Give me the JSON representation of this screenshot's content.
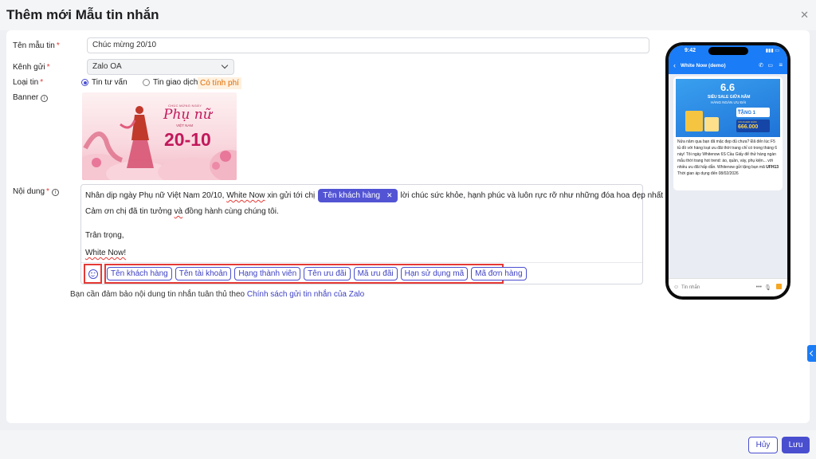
{
  "modal": {
    "title": "Thêm mới Mẫu tin nhắn",
    "close_icon": "close-icon"
  },
  "form": {
    "template_name": {
      "label": "Tên mẫu tin",
      "value": "Chúc mừng 20/10"
    },
    "channel": {
      "label": "Kênh gửi",
      "value": "Zalo OA"
    },
    "message_type": {
      "label": "Loại tin",
      "options": [
        "Tin tư vấn",
        "Tin giao dịch"
      ],
      "selected": "Tin tư vấn",
      "paid_badge": "Có tính phí"
    },
    "banner": {
      "label": "Banner",
      "image_text": {
        "small": "CHÚC MỪNG NGÀY",
        "script": "Phụ nữ",
        "country": "VIỆT NAM",
        "date": "20-10"
      }
    },
    "content": {
      "label": "Nội dung",
      "line1_before": "Nhân dịp ngày Phụ nữ Việt Nam 20/10, ",
      "line1_brand": "White Now",
      "line1_mid": " xin gửi tới chị",
      "inline_tag": "Tên khách hàng",
      "line1_after": "lời chúc sức khỏe, hạnh phúc và luôn rực rỡ như những đóa hoa đẹp nhất ",
      "line2_a": "Cảm ơn chị đã tin tưởng ",
      "line2_b": "và",
      "line2_c": " đồng hành cùng chúng tôi.",
      "line3": "Trân trọng,",
      "line4": "White Now!",
      "tags": [
        "Tên khách hàng",
        "Tên tài khoản",
        "Hạng thành viên",
        "Tên ưu đãi",
        "Mã ưu đãi",
        "Hạn sử dụng mã",
        "Mã đơn hàng"
      ]
    },
    "notice_prefix": "Bạn cần đảm bảo nội dung tin nhắn tuân thủ theo ",
    "notice_link": "Chính sách gửi tin nhắn của Zalo"
  },
  "preview": {
    "time": "9:42",
    "contact": "White Now (demo)",
    "promo": {
      "big": "6.6",
      "headline1": "SIÊU SALE GIỮA NĂM",
      "headline2": "HÀNG NGÀN ƯU ĐÃI",
      "badge1_small": "MUA",
      "badge1_big": "TẶNG 1",
      "badge2_small": "VOUCHER GIẢM",
      "badge2_big": "666.000"
    },
    "message_parts": [
      "Nửa năm qua bạn đã mặc đẹp đủ chưa? Đã đến lúc F5 tủ đồ với hàng loạt ưu đãi thời trang chỉ có trong tháng 6 này! Tôi ngày Whitenow 6S Cầu Giấy để thử hàng ngàn mẫu thời trang hot trend: áo, quần, váy, phụ kiện... với nhiều ưu đãi hấp dẫn. Whitenow gửi tặng bạn mã ",
      "UFH13",
      " Thời gian áp dụng đến 08/02/2026"
    ],
    "input_placeholder": "Tin nhắn"
  },
  "footer": {
    "cancel": "Hủy",
    "save": "Lưu"
  },
  "colors": {
    "accent": "#4a4fd0",
    "zalo_blue": "#1a7cf6",
    "highlight": "#e53935"
  }
}
